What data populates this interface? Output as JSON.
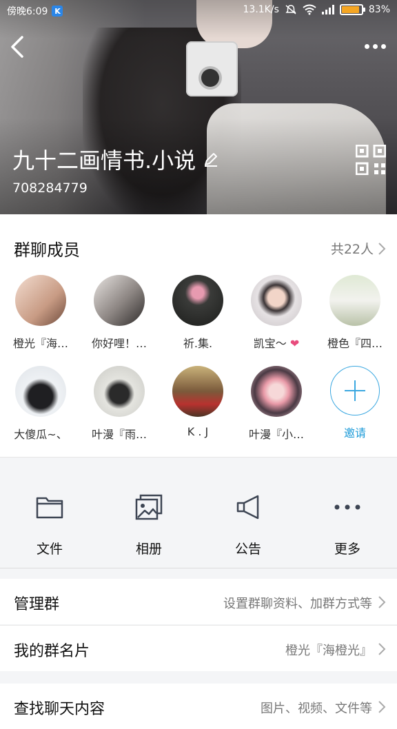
{
  "status_bar": {
    "time": "傍晚6:09",
    "app_icon_text": "K",
    "speed": "13.1K/s",
    "battery_percent": "83%",
    "battery_level": 0.83,
    "battery_color": "#f5a623"
  },
  "header": {
    "group_name": "九十二画情书.小说",
    "group_id": "708284779",
    "icons": [
      "back-icon",
      "more-icon",
      "edit-icon",
      "qr-code-icon"
    ]
  },
  "members": {
    "heading": "群聊成员",
    "count": "共22人",
    "list": [
      {
        "name": "橙光『海…",
        "color": "#e9c9b2"
      },
      {
        "name": "你好哩！…",
        "color": "#c9c2bd"
      },
      {
        "name": "祈.集.",
        "color": "#3a3b39"
      },
      {
        "name": "凯宝～",
        "color": "#d9d3d7",
        "badge": "❤"
      },
      {
        "name": "橙色『四…",
        "color": "#cfd7c3"
      },
      {
        "name": "大傻瓜~、",
        "color": "#dfe3e8"
      },
      {
        "name": "叶漫『雨…",
        "color": "#d6d6d2"
      },
      {
        "name": "K . J",
        "color": "#7b5a3b"
      },
      {
        "name": "叶漫『小…",
        "color": "#f0c7cf"
      }
    ],
    "invite_label": "邀请",
    "accent_color": "#1d9bd8"
  },
  "actions": [
    {
      "label": "文件",
      "icon": "folder-icon"
    },
    {
      "label": "相册",
      "icon": "album-icon"
    },
    {
      "label": "公告",
      "icon": "megaphone-icon"
    },
    {
      "label": "更多",
      "icon": "more-dots-icon"
    }
  ],
  "rows": [
    {
      "title": "管理群",
      "value": "设置群聊资料、加群方式等"
    },
    {
      "title": "我的群名片",
      "value": "橙光『海橙光』"
    },
    {
      "title": "查找聊天内容",
      "value": "图片、视频、文件等"
    }
  ]
}
